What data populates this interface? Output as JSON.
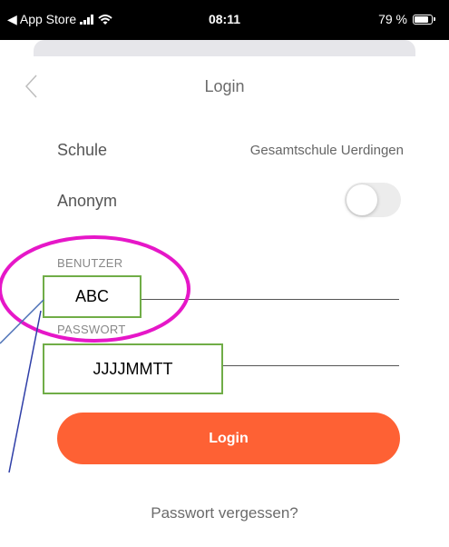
{
  "status_bar": {
    "back_app": "◀ App Store",
    "time": "08:11",
    "battery": "79 %",
    "battery_level": 0.79
  },
  "nav": {
    "title": "Login"
  },
  "form": {
    "school_label": "Schule",
    "school_value": "Gesamtschule Uerdingen",
    "anonym_label": "Anonym",
    "anonym_on": false,
    "user_label": "BENUTZER",
    "user_value": "ABC",
    "password_label": "PASSWORT",
    "password_value": "JJJJMMTT",
    "login_label": "Login",
    "forgot_label": "Passwort vergessen?"
  },
  "colors": {
    "accent": "#fe6134",
    "annotation_ellipse": "#e617c8",
    "annotation_box": "#70ad47",
    "annotation_line": "#2f3fa8"
  }
}
